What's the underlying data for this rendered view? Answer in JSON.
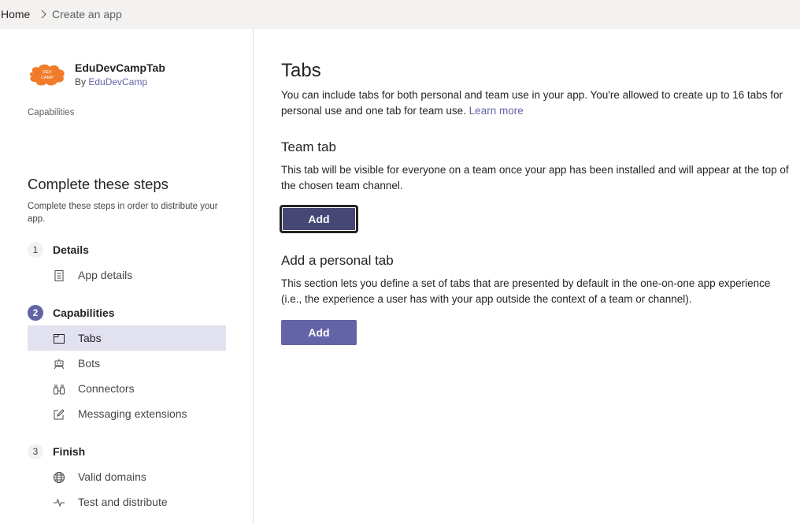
{
  "breadcrumb": {
    "home": "Home",
    "current": "Create an app"
  },
  "app": {
    "logo_text_top": "DEV",
    "logo_text_bottom": "CAMP",
    "name": "EduDevCampTab",
    "by_prefix": "By ",
    "by_author": "EduDevCamp",
    "capabilities_label": "Capabilities"
  },
  "steps": {
    "title": "Complete these steps",
    "description": "Complete these steps in order to distribute your app.",
    "groups": [
      {
        "number": "1",
        "label": "Details",
        "items": [
          {
            "label": "App details",
            "icon": "document-icon"
          }
        ]
      },
      {
        "number": "2",
        "label": "Capabilities",
        "items": [
          {
            "label": "Tabs",
            "icon": "tab-icon",
            "selected": true
          },
          {
            "label": "Bots",
            "icon": "bot-icon"
          },
          {
            "label": "Connectors",
            "icon": "connector-icon"
          },
          {
            "label": "Messaging extensions",
            "icon": "edit-icon"
          }
        ]
      },
      {
        "number": "3",
        "label": "Finish",
        "items": [
          {
            "label": "Valid domains",
            "icon": "globe-icon"
          },
          {
            "label": "Test and distribute",
            "icon": "activity-icon"
          }
        ]
      }
    ]
  },
  "main": {
    "title": "Tabs",
    "description": "You can include tabs for both personal and team use in your app. You're allowed to create up to 16 tabs for personal use and one tab for team use.",
    "learn_more": "Learn more",
    "team_tab": {
      "title": "Team tab",
      "description": "This tab will be visible for everyone on a team once your app has been installed and will appear at the top of the chosen team channel.",
      "button": "Add"
    },
    "personal_tab": {
      "title": "Add a personal tab",
      "description": "This section lets you define a set of tabs that are presented by default in the one-on-one app experience (i.e., the experience a user has with your app outside the context of a team or channel).",
      "button": "Add"
    }
  },
  "colors": {
    "accent": "#6264a7",
    "accent_dark": "#464775",
    "selected_bg": "#e1e1f0",
    "logo": "#f07c2b"
  }
}
